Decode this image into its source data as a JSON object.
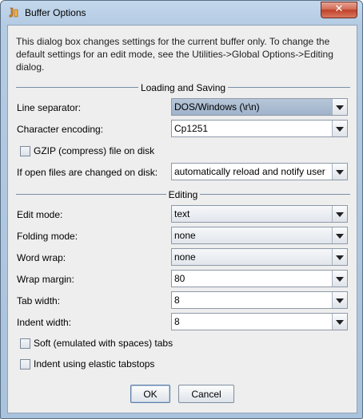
{
  "window": {
    "title": "Buffer Options",
    "close_glyph": "✕"
  },
  "description": "This dialog box changes settings for the current buffer only. To change the default settings for an edit mode, see the Utilities->Global Options->Editing dialog.",
  "loading_saving": {
    "heading": "Loading and Saving",
    "line_separator": {
      "label": "Line separator:",
      "value": "DOS/Windows (\\r\\n)"
    },
    "character_encoding": {
      "label": "Character encoding:",
      "value": "Cp1251"
    },
    "gzip": {
      "label": "GZIP (compress) file on disk",
      "checked": false
    },
    "open_files_changed": {
      "label": "If open files are changed on disk:",
      "value": "automatically reload and notify user"
    }
  },
  "editing": {
    "heading": "Editing",
    "edit_mode": {
      "label": "Edit mode:",
      "value": "text"
    },
    "folding_mode": {
      "label": "Folding mode:",
      "value": "none"
    },
    "word_wrap": {
      "label": "Word wrap:",
      "value": "none"
    },
    "wrap_margin": {
      "label": "Wrap margin:",
      "value": "80"
    },
    "tab_width": {
      "label": "Tab width:",
      "value": "8"
    },
    "indent_width": {
      "label": "Indent width:",
      "value": "8"
    },
    "soft_tabs": {
      "label": "Soft (emulated with spaces) tabs",
      "checked": false
    },
    "elastic_tabstops": {
      "label": "Indent using elastic tabstops",
      "checked": false
    }
  },
  "buttons": {
    "ok": "OK",
    "cancel": "Cancel"
  },
  "icons": {
    "app": "jedit-app-icon",
    "close": "close-icon"
  }
}
